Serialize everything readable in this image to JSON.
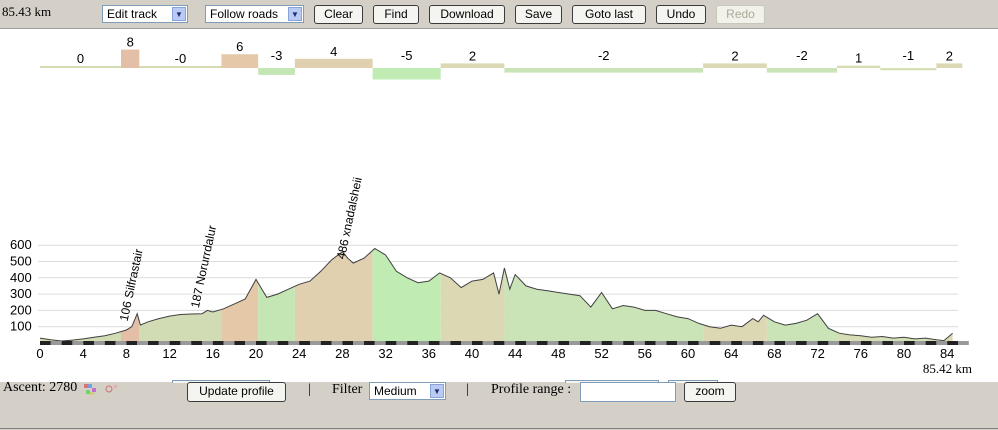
{
  "toolbar": {
    "distance": "85.43 km",
    "mode_select": "Edit track",
    "routing_select": "Follow roads",
    "clear_label": "Clear",
    "find_label": "Find",
    "download_label": "Download",
    "save_label": "Save",
    "goto_last_label": "Goto last",
    "undo_label": "Undo",
    "redo_label": "Redo"
  },
  "chart_data": {
    "type": "area",
    "x_ticks": [
      0,
      4,
      8,
      12,
      16,
      20,
      24,
      28,
      32,
      36,
      40,
      44,
      48,
      52,
      56,
      60,
      64,
      68,
      72,
      76,
      80,
      84
    ],
    "y_ticks": [
      100,
      200,
      300,
      400,
      500,
      600
    ],
    "total_distance_label": "85.42 km",
    "profile": [
      [
        0,
        30
      ],
      [
        1,
        20
      ],
      [
        2,
        12
      ],
      [
        3,
        18
      ],
      [
        4,
        25
      ],
      [
        5,
        35
      ],
      [
        6,
        45
      ],
      [
        7,
        60
      ],
      [
        8,
        80
      ],
      [
        8.5,
        100
      ],
      [
        9,
        180
      ],
      [
        9.3,
        110
      ],
      [
        10,
        130
      ],
      [
        11,
        150
      ],
      [
        12,
        165
      ],
      [
        13,
        175
      ],
      [
        14,
        178
      ],
      [
        15,
        180
      ],
      [
        15.5,
        200
      ],
      [
        16,
        190
      ],
      [
        17,
        210
      ],
      [
        18,
        240
      ],
      [
        19,
        270
      ],
      [
        20,
        390
      ],
      [
        21,
        280
      ],
      [
        22,
        300
      ],
      [
        23,
        330
      ],
      [
        24,
        360
      ],
      [
        25,
        380
      ],
      [
        26,
        440
      ],
      [
        27,
        510
      ],
      [
        28,
        560
      ],
      [
        28.5,
        520
      ],
      [
        29,
        490
      ],
      [
        30,
        520
      ],
      [
        31,
        580
      ],
      [
        32,
        540
      ],
      [
        33,
        440
      ],
      [
        34,
        400
      ],
      [
        35,
        370
      ],
      [
        36,
        380
      ],
      [
        37,
        430
      ],
      [
        38,
        400
      ],
      [
        39,
        340
      ],
      [
        40,
        380
      ],
      [
        41,
        390
      ],
      [
        42,
        430
      ],
      [
        42.5,
        300
      ],
      [
        43,
        460
      ],
      [
        43.5,
        330
      ],
      [
        44,
        420
      ],
      [
        45,
        350
      ],
      [
        46,
        330
      ],
      [
        47,
        320
      ],
      [
        48,
        310
      ],
      [
        49,
        300
      ],
      [
        50,
        290
      ],
      [
        51,
        220
      ],
      [
        52,
        310
      ],
      [
        53,
        210
      ],
      [
        54,
        230
      ],
      [
        55,
        220
      ],
      [
        56,
        200
      ],
      [
        57,
        200
      ],
      [
        58,
        180
      ],
      [
        59,
        160
      ],
      [
        60,
        150
      ],
      [
        61,
        120
      ],
      [
        62,
        100
      ],
      [
        63,
        90
      ],
      [
        64,
        110
      ],
      [
        65,
        100
      ],
      [
        66,
        150
      ],
      [
        66.5,
        130
      ],
      [
        67,
        170
      ],
      [
        68,
        130
      ],
      [
        69,
        110
      ],
      [
        70,
        120
      ],
      [
        71,
        140
      ],
      [
        72,
        180
      ],
      [
        73,
        90
      ],
      [
        74,
        60
      ],
      [
        75,
        50
      ],
      [
        76,
        45
      ],
      [
        77,
        35
      ],
      [
        78,
        40
      ],
      [
        79,
        30
      ],
      [
        80,
        35
      ],
      [
        81,
        25
      ],
      [
        82,
        30
      ],
      [
        83,
        20
      ],
      [
        83.7,
        15
      ],
      [
        84.5,
        60
      ]
    ],
    "segments": [
      {
        "x0": 0,
        "x1": 7.5,
        "grade": "0",
        "color": "#d2dcb4"
      },
      {
        "x0": 7.5,
        "x1": 9.2,
        "grade": "8",
        "color": "#e4bfa8"
      },
      {
        "x0": 9.2,
        "x1": 16.8,
        "grade": "-0",
        "color": "#d2dcb4"
      },
      {
        "x0": 16.8,
        "x1": 20.2,
        "grade": "6",
        "color": "#e4c8a8"
      },
      {
        "x0": 20.2,
        "x1": 23.6,
        "grade": "-3",
        "color": "#c4e6b4"
      },
      {
        "x0": 23.6,
        "x1": 30.8,
        "grade": "4",
        "color": "#e0d0b0"
      },
      {
        "x0": 30.8,
        "x1": 37.1,
        "grade": "-5",
        "color": "#c0ecb4"
      },
      {
        "x0": 37.1,
        "x1": 43,
        "grade": "2",
        "color": "#dcd8b4"
      },
      {
        "x0": 43,
        "x1": 61.4,
        "grade": "-2",
        "color": "#cae4b8"
      },
      {
        "x0": 61.4,
        "x1": 67.3,
        "grade": "2",
        "color": "#dcd8b4"
      },
      {
        "x0": 67.3,
        "x1": 73.8,
        "grade": "-2",
        "color": "#cae4b8"
      },
      {
        "x0": 73.8,
        "x1": 77.8,
        "grade": "1",
        "color": "#d8dcb4"
      },
      {
        "x0": 77.8,
        "x1": 83.0,
        "grade": "-1",
        "color": "#d4e0b8"
      },
      {
        "x0": 83.0,
        "x1": 85.4,
        "grade": "2",
        "color": "#dcd8b4"
      }
    ],
    "waypoints": [
      {
        "x": 8.1,
        "elev": 106,
        "label": "106 Silfrastair"
      },
      {
        "x": 14.7,
        "elev": 187,
        "label": "187 Norurrdalur"
      },
      {
        "x": 28.2,
        "elev": 486,
        "label": "486 xnadalsheii"
      }
    ]
  },
  "footer": {
    "ascent": "Ascent: 2780",
    "update_profile_label": "Update profile",
    "separator": "|",
    "filter_label": "Filter",
    "filter_value": "Medium",
    "profile_range_label": "Profile range :",
    "profile_range_value": "",
    "zoom_label": "zoom"
  }
}
